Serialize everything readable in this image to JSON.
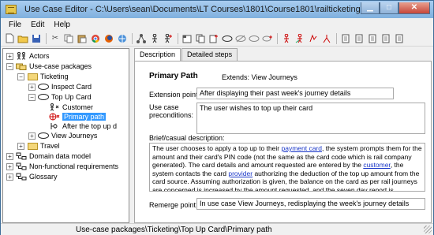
{
  "window": {
    "title": "Use Case Editor - C:\\Users\\sean\\Documents\\LT Courses\\1801\\Course1801\\railticketing.xml"
  },
  "menu": [
    "File",
    "Edit",
    "Help"
  ],
  "toolbar_icons": [
    "new-file-icon",
    "open-folder-icon",
    "save-icon",
    "cut-icon",
    "copy-icon",
    "paste-icon",
    "chrome-icon",
    "firefox-icon",
    "web-icon",
    "network-icon",
    "actor-icon",
    "add-actor-icon",
    "tab-icon",
    "copy-doc-icon",
    "add-doc-icon",
    "ellipse-icon",
    "no-ellipse-icon",
    "sub-ellipse-icon",
    "add-sub-icon",
    "actor-red-icon",
    "actor-arrow-icon",
    "delete-icon",
    "fork-icon",
    "doc1-icon",
    "doc2-icon",
    "doc3-icon",
    "doc4-icon",
    "doc5-icon"
  ],
  "tree": [
    {
      "level": 0,
      "label": "Actors",
      "expander": "+",
      "icon": "actors-icon"
    },
    {
      "level": 0,
      "label": "Use-case packages",
      "expander": "-",
      "icon": "packages-icon"
    },
    {
      "level": 1,
      "label": "Ticketing",
      "expander": "-",
      "icon": "folder-icon"
    },
    {
      "level": 2,
      "label": "Inspect Card",
      "expander": "+",
      "icon": "ellipse-icon"
    },
    {
      "level": 2,
      "label": "Top Up Card",
      "expander": "-",
      "icon": "ellipse-icon"
    },
    {
      "level": 3,
      "label": "Customer",
      "expander": "",
      "icon": "actor-icon"
    },
    {
      "level": 3,
      "label": "Primary path",
      "expander": "",
      "icon": "path-icon",
      "selected": true
    },
    {
      "level": 3,
      "label": "After the top up d",
      "expander": "",
      "icon": "branch-icon"
    },
    {
      "level": 2,
      "label": "View Journeys",
      "expander": "+",
      "icon": "ellipse-icon"
    },
    {
      "level": 1,
      "label": "Travel",
      "expander": "+",
      "icon": "folder-icon"
    },
    {
      "level": 0,
      "label": "Domain data model",
      "expander": "+",
      "icon": "model-icon"
    },
    {
      "level": 0,
      "label": "Non-functional requirements",
      "expander": "+",
      "icon": "nfr-icon"
    },
    {
      "level": 0,
      "label": "Glossary",
      "expander": "+",
      "icon": "glossary-icon"
    }
  ],
  "tabs": [
    "Description",
    "Detailed steps"
  ],
  "detail": {
    "heading": "Primary Path",
    "extends": "Extends: View Journeys",
    "extension_point_label": "Extension point:",
    "extension_point_value": "After displaying their past week's journey details",
    "preconditions_label_1": "Use case",
    "preconditions_label_2": "preconditions:",
    "preconditions_value": "The user wishes to top up their card",
    "brief_label": "Brief/casual description:",
    "brief": {
      "p1": "The user chooses to apply a top up to their ",
      "link1": "payment card",
      "p2": ", the system prompts them for the amount and their card's PIN code (not the same as the card code which is rail company generated). The card details and amount requested are entered by the ",
      "link2": "customer",
      "p3": ", the system contacts the card ",
      "link3": "provider",
      "p4": " authorizing the deduction of the top up amount from the card source. Assuming authorization is given, the balance on the card as per rail journeys are concerned is increased by the amount requested, and the seven day report is displayed afresh."
    },
    "remerge_label": "Remerge point:",
    "remerge_value": "In use case View Journeys, redisplaying the week's journey details"
  },
  "status": "Use-case packages\\Ticketing\\Top Up Card\\Primary path",
  "colors": {
    "selection": "#3399ff",
    "link": "#1a37c8",
    "title_gradient_top": "#a9cdf0"
  }
}
